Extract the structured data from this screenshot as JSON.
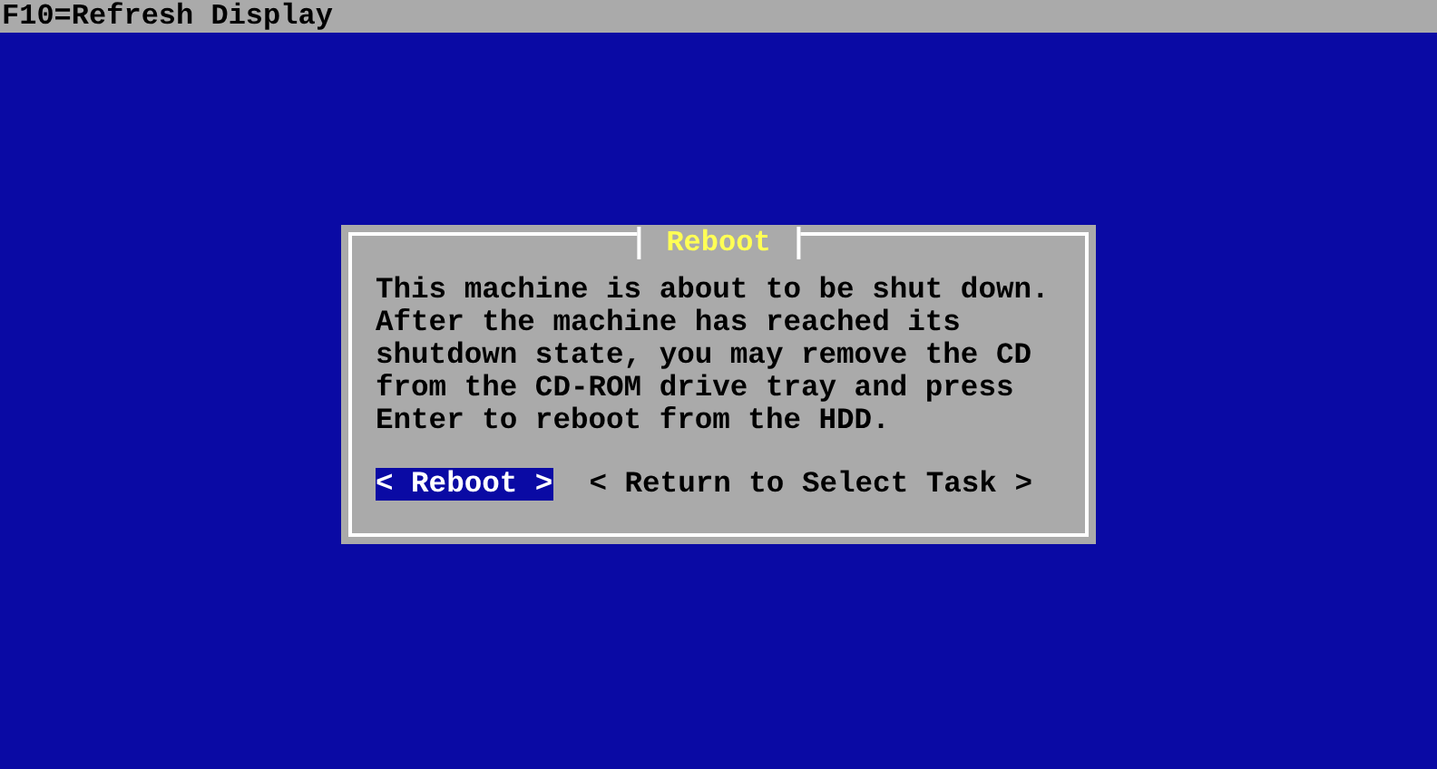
{
  "top_bar": {
    "text": "F10=Refresh Display"
  },
  "dialog": {
    "title": "Reboot",
    "message": [
      "This machine is about to be shut down.",
      "After the machine has reached its",
      "shutdown state, you may remove the CD",
      "from the CD-ROM drive tray and press",
      "Enter to reboot from the HDD."
    ],
    "buttons": [
      {
        "label": "< Reboot >",
        "selected": true
      },
      {
        "label": "< Return to Select Task >",
        "selected": false
      }
    ]
  }
}
